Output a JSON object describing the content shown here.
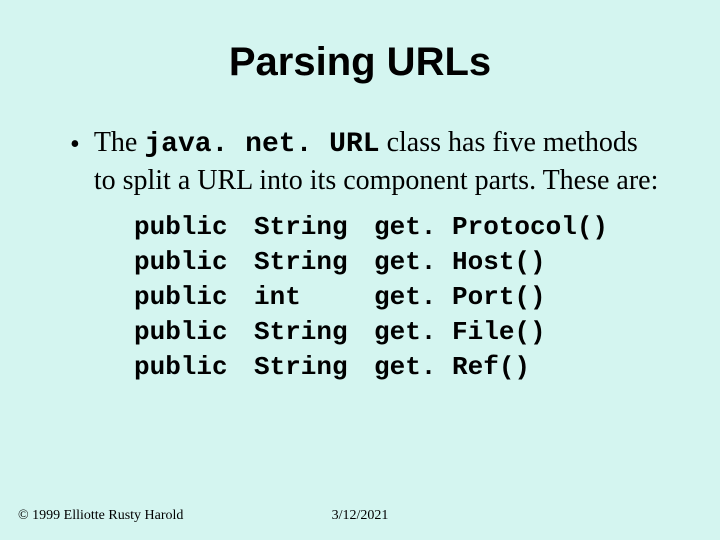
{
  "title": "Parsing URLs",
  "bullet": {
    "pre": "The ",
    "code": "java. net. URL",
    "post": " class has five methods to split a URL into its component parts. These are:"
  },
  "methods": [
    {
      "mod": "public",
      "type": "String",
      "name": "get. Protocol()"
    },
    {
      "mod": "public",
      "type": "String",
      "name": "get. Host()"
    },
    {
      "mod": "public",
      "type": "int",
      "name": "get. Port()"
    },
    {
      "mod": "public",
      "type": "String",
      "name": "get. File()"
    },
    {
      "mod": "public",
      "type": "String",
      "name": "get. Ref()"
    }
  ],
  "footer": {
    "copyright": "© 1999 Elliotte Rusty Harold",
    "date": "3/12/2021"
  }
}
